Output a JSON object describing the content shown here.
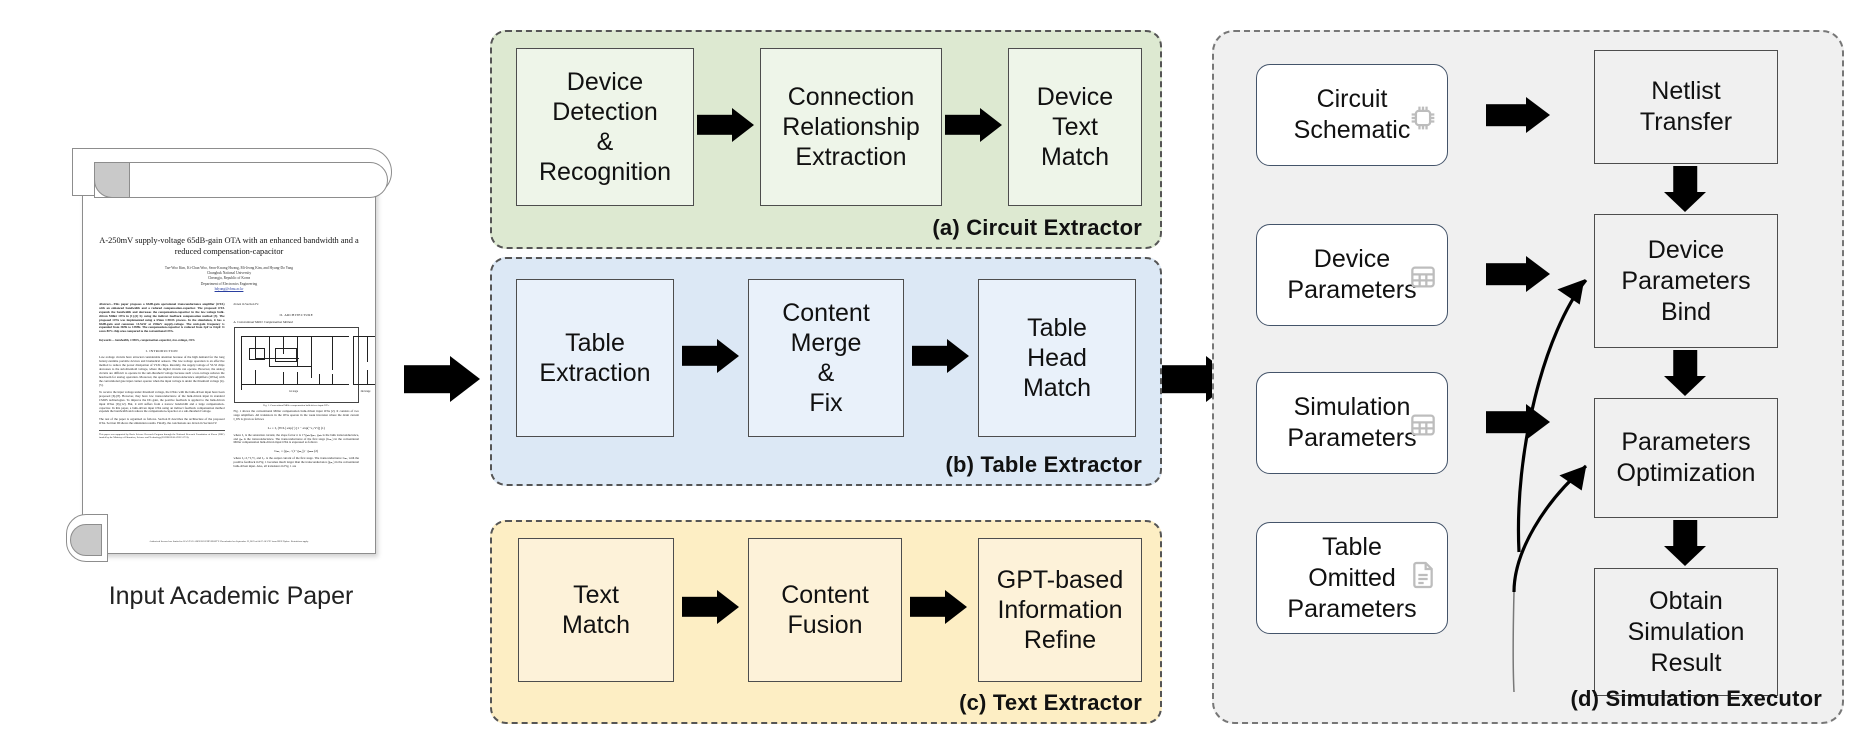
{
  "input": {
    "caption": "Input Academic Paper",
    "paper": {
      "title": "A-250mV supply-voltage 65dB-gain OTA with an enhanced bandwidth and a reduced compensation-capacitor",
      "authors": "Tae-Woo Kim, Ki-Chan Woo, Seon-Kwang Hwang, Mi-Jeong Kim, and Hyung-Do Yang",
      "affiliation_1": "Chungbuk National University",
      "affiliation_2": "Cheongju, Republic of Korea",
      "affiliation_3": "Department of Electronics Engineering",
      "email": "hdyang@cbnu.ac.kr",
      "abstract": "Abstract—This paper proposes a 65dB-gain operational transconductance amplifier (OTA) with an enhanced bandwidth and a reduced compensation-capacitor. The proposed OTA expands the bandwidth and decreases the compensation-capacitor in the low-voltage bulk-driven Miller OTA in [1]-[2] by using the indirect feedback compensation method [3]. The proposed OTA was implemented using a 65nm CMOS process. In the simulation, it has a 65dB-gain and consumes 14.5nW at 250mV supply-voltage. The unit-gain frequency is expanded from 36Hz to 138Hz. The compensation-capacitor is reduced from 3pF to 0.6pF. It saves 80% chip area compared to the conventional OTA.",
      "keywords": "Keywords— bandwidth, CMOS, compensation-capacitor, low-voltage, OTA",
      "section_1": "I.     INTRODUCTION",
      "intro_p1": "Low-voltage circuits have attracted considerable attention because of the high demand for the long battery-runtime portable devices and biomedical sensors. The low-voltage operation is an effective method to reduce the power dissipation of VLSI chips. Recently, the supply-voltage of VLSI chips decreases to the sub-threshold voltage, where the digital circuits can operate. However, the analog circuits are difficult to operate in the sub-threshold voltage because such a low-voltage reduces the headroom for analog operation. Moreover, the operational transconductance amplifiers (OTAs) with the conventional gate input cannot operate when the input voltage is under the threshold voltage [4]-[5].",
      "intro_p2": "To receive the input voltage under threshold voltage, the OTAs with the bulk-driven input have been proposed [6]-[8]. However, they have low transconductance of the bulk-driven input in standard CMOS technologies. To improve the DC-gain, the positive feedback is applied to the bulk-driven input OTAs [9]-[12]. But, it still suffers from a narrow bandwidth and a large compensation-capacitor. In this paper, a bulk-driven input OTA using an indirect feedback compensation method expands the bandwidth and reduces the compensation-capacitor at a sub-threshold voltage.",
      "intro_p3": "The rest of the paper is organized as follows. Section II describes the architecture of the proposed OTA. Section III shows the simulation results. Finally, the conclusions are drawn in Section IV.",
      "right_top": "drawn in Section IV.",
      "section_2": "II.     ARCHITECTURE",
      "subsection_a": "A.   Conventional Miller Compensation Method",
      "fig_caption": "Fig. 1. Conventional Miller compensation bulk-driven input OTA.",
      "fig_stage1": "1st stage",
      "fig_stage2": "2nd stage",
      "arch_p1": "Fig. 1 shows the conventional Miller compensation bulk-driven input OTA [2]. It consists of two stage amplifiers. All transistors in the OTA operate in the weak inversion where the drain current I_DS is given as follows",
      "eq1": "Iₒₛ = I₀ (W/L) exp(·) [1 − exp(−v₀/Vₜ)]            (1)",
      "arch_p2": "where I₀ is the saturation current, the slope factor n is 1+gₘₕ/gₘₛ, gₘₕ is the bulk transconductance, and gₘ is the transconductance. The transconductance of the first stage (Gₘ₁) in the conventional Miller compensation bulk-driven input OTA is expressed as follows",
      "eq2": "Gₘ₁ = (gₘ₁ / (1−gₘ₂)) · gₘₘ              (2)",
      "arch_p3": "where I₀=I₁+I₂+I₃ and I₀ᵤ is the output current of the first stage. The transconductance Gₘ₁ with the positive feedback in Fig. 1 becomes much larger than the transconductance (gₘ₁) in the conventional bulk-driven input. Also, all transistors in Fig. 1 are",
      "footnote": "This paper was supported by Basic Science Research Program through the National Research Foundation of Korea (NRF) funded by the Ministry of Education, Science and Technology(2019R01E-KAX3151774).",
      "bottom_line": "Authorized licensed use limited to: BAO TAO ABOULIOUNIVERSITY. Downloaded on September 23,2023 at 04:27:10 UTC from IEEE Xplore.  Restrictions apply."
    }
  },
  "main_arrows": {
    "to_extractors": "arrow-right",
    "to_executor": "arrow-right"
  },
  "extractors": [
    {
      "id": "a",
      "label": "(a) Circuit Extractor",
      "panel_bg": "#dde9d1",
      "box_bg": "#eef5e9",
      "steps": [
        "Device\nDetection\n&\nRecognition",
        "Connection\nRelationship\nExtraction",
        "Device\nText\nMatch"
      ]
    },
    {
      "id": "b",
      "label": "(b) Table Extractor",
      "panel_bg": "#dce8f5",
      "box_bg": "#e9f1fa",
      "steps": [
        "Table\nExtraction",
        "Content\nMerge\n&\nFix",
        "Table\nHead\nMatch"
      ]
    },
    {
      "id": "c",
      "label": "(c) Text Extractor",
      "panel_bg": "#fdeec4",
      "box_bg": "#fdf2d9",
      "steps": [
        "Text\nMatch",
        "Content\nFusion",
        "GPT-based\nInformation\nRefine"
      ]
    }
  ],
  "executor": {
    "label": "(d) Simulation Executor",
    "panel_bg": "#f0f0f0",
    "sources": [
      {
        "text": "Circuit\nSchematic",
        "icon": "chip-icon"
      },
      {
        "text": "Device\nParameters",
        "icon": "table-icon"
      },
      {
        "text": "Simulation\nParameters",
        "icon": "table-icon"
      },
      {
        "text": "Table\nOmitted\nParameters",
        "icon": "document-icon"
      }
    ],
    "processes": [
      "Netlist\nTransfer",
      "Device\nParameters\nBind",
      "Parameters\nOptimization",
      "Obtain\nSimulation\nResult"
    ]
  }
}
